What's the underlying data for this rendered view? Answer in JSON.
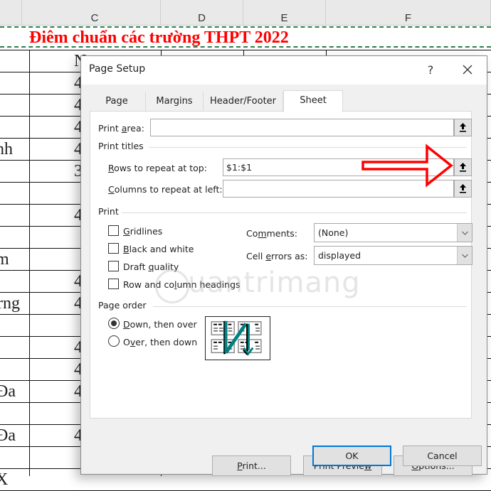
{
  "spreadsheet": {
    "column_headers": [
      "C",
      "D",
      "E",
      "F"
    ],
    "title": "Điêm chuẩn các trường THPT 2022",
    "row_fragments": {
      "col_c_partial": [
        "N",
        "4",
        "4",
        "4",
        "4",
        "3",
        "",
        "4",
        "",
        "",
        "4",
        "4",
        "",
        "4",
        "4",
        "4",
        "",
        "4",
        "",
        ""
      ],
      "left_partial": [
        "",
        "",
        "",
        "",
        "nh",
        "",
        "",
        "",
        "",
        "m",
        "",
        "rng",
        "",
        "",
        "",
        "Đa",
        "",
        "Đa",
        "",
        "X"
      ]
    }
  },
  "dialog": {
    "title": "Page Setup",
    "help_label": "?",
    "tabs": [
      {
        "label": "Page",
        "active": false
      },
      {
        "label": "Margins",
        "active": false
      },
      {
        "label": "Header/Footer",
        "active": false
      },
      {
        "label": "Sheet",
        "active": true
      }
    ],
    "print_area": {
      "label": "Print area:",
      "underline": "a",
      "value": ""
    },
    "print_titles": {
      "group_label": "Print titles",
      "rows_to_repeat": {
        "label": "Rows to repeat at top:",
        "value": "$1:$1"
      },
      "columns_to_repeat": {
        "label": "Columns to repeat at left:",
        "value": ""
      }
    },
    "print": {
      "group_label": "Print",
      "checkboxes": [
        {
          "label": "Gridlines",
          "checked": false
        },
        {
          "label": "Black and white",
          "checked": false
        },
        {
          "label": "Draft quality",
          "checked": false
        },
        {
          "label": "Row and column headings",
          "checked": false
        }
      ],
      "comments": {
        "label": "Comments:",
        "value": "(None)"
      },
      "cell_errors": {
        "label": "Cell errors as:",
        "value": "displayed"
      }
    },
    "page_order": {
      "group_label": "Page order",
      "options": [
        {
          "label": "Down, then over",
          "selected": true
        },
        {
          "label": "Over, then down",
          "selected": false
        }
      ]
    },
    "buttons": {
      "print": "Print...",
      "print_preview": "Print Preview",
      "options": "Options...",
      "ok": "OK",
      "cancel": "Cancel"
    }
  },
  "annotation": {
    "type": "red-arrow",
    "points_to": "rows-to-repeat-collapse-button",
    "color": "#ff0000"
  },
  "watermark": "uantrimang",
  "colors": {
    "title_red": "#ff0000",
    "accent_blue": "#0078d7",
    "print_border_green": "#2e7d4f",
    "arrow_teal": "#008080"
  }
}
